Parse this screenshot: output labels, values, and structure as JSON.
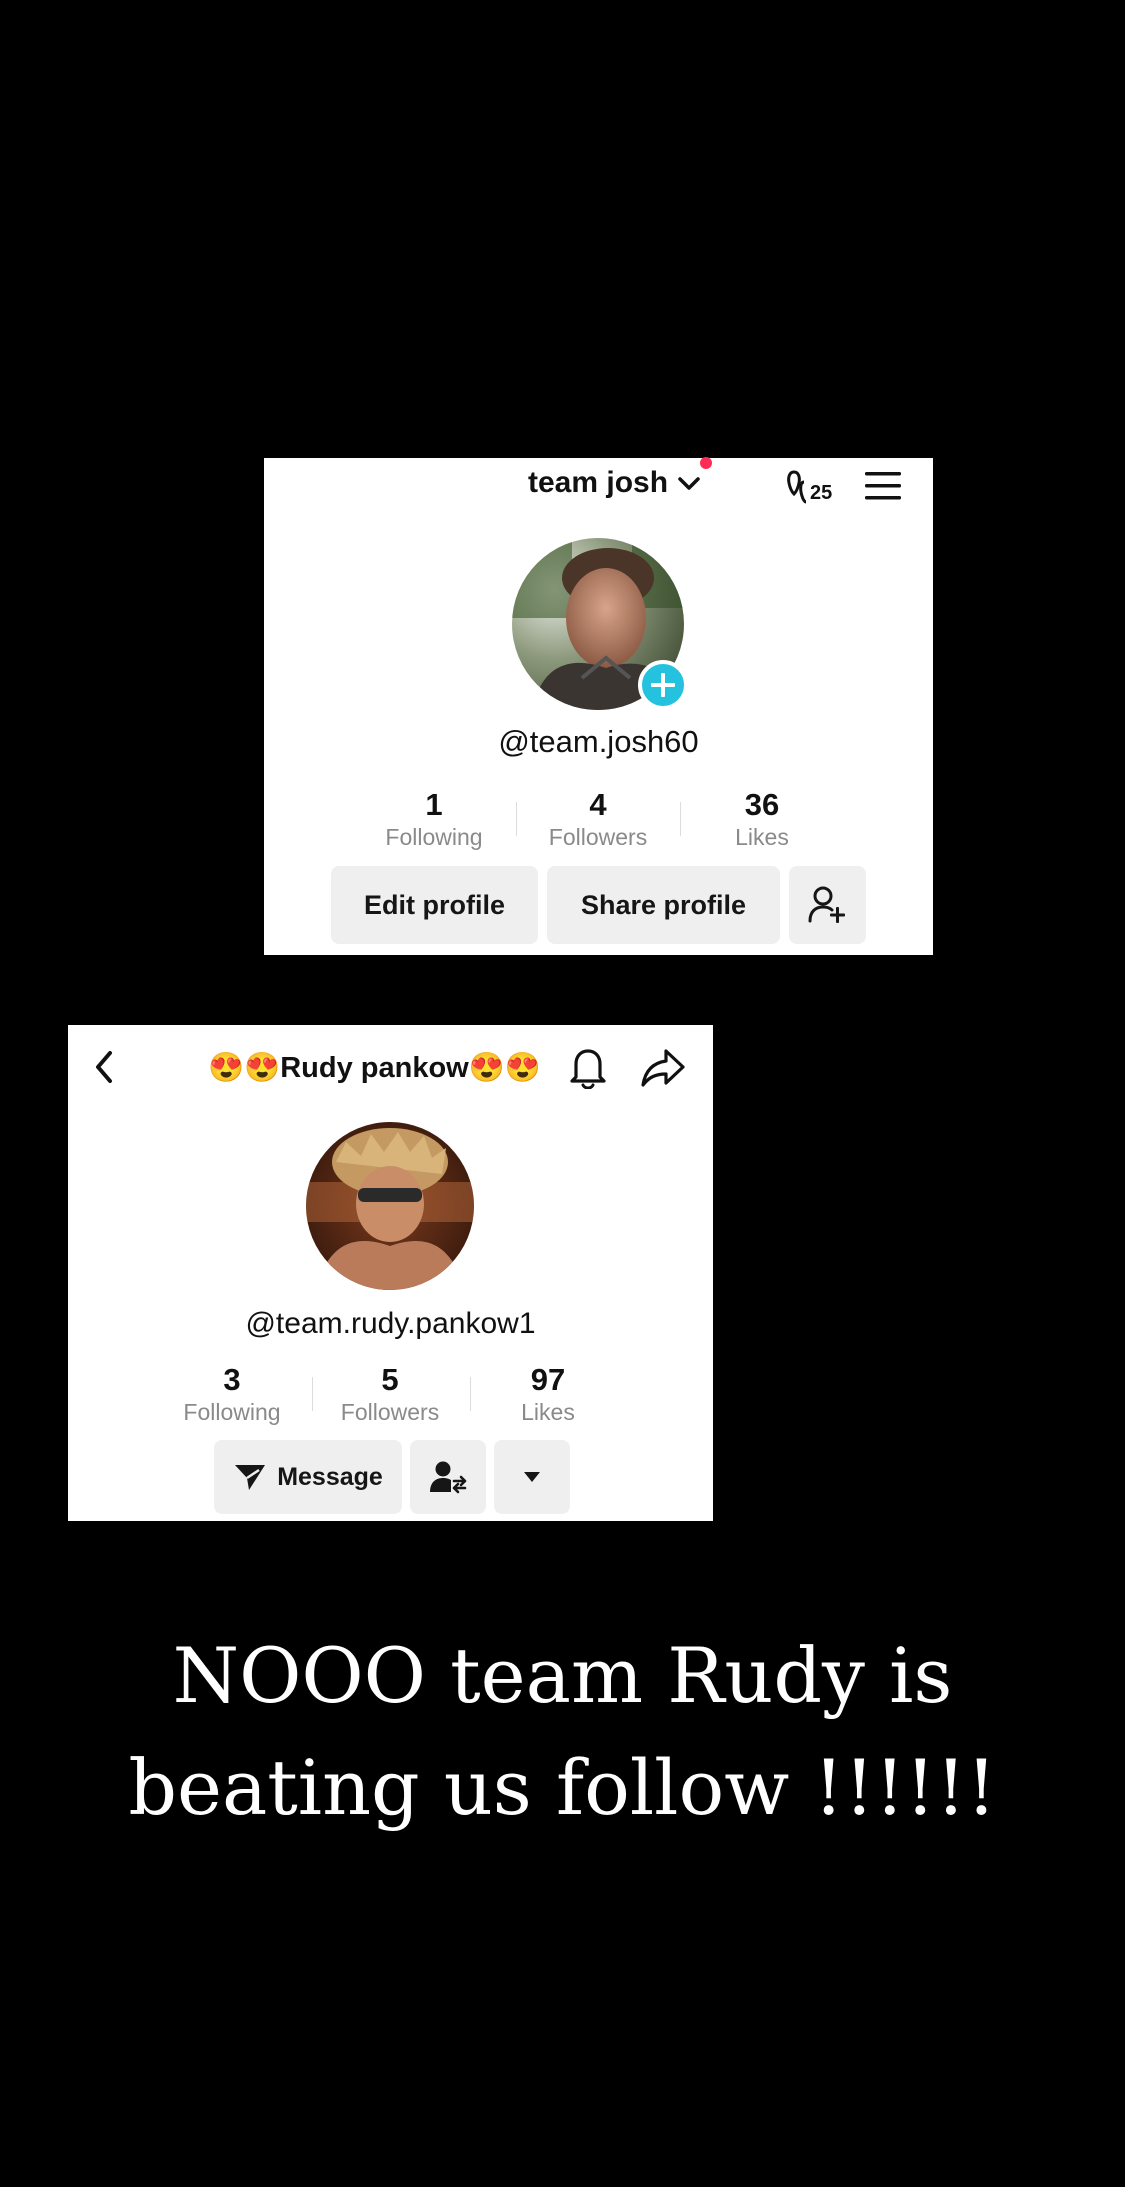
{
  "profile_mine": {
    "title": "team josh",
    "handle": "@team.josh60",
    "stats": [
      {
        "value": "1",
        "label": "Following"
      },
      {
        "value": "4",
        "label": "Followers"
      },
      {
        "value": "36",
        "label": "Likes"
      }
    ],
    "edit_label": "Edit profile",
    "share_label": "Share profile",
    "badge_count": "25",
    "icons": [
      "chevron-down-icon",
      "footprint-icon",
      "menu-icon",
      "add-story-icon",
      "add-friend-icon"
    ],
    "accent_color": "#25c2e0",
    "notification_dot_color": "#fe2c55"
  },
  "profile_other": {
    "title": "😍😍Rudy pankow😍😍",
    "handle": "@team.rudy.pankow1",
    "stats": [
      {
        "value": "3",
        "label": "Following"
      },
      {
        "value": "5",
        "label": "Followers"
      },
      {
        "value": "97",
        "label": "Likes"
      }
    ],
    "message_label": "Message",
    "icons": [
      "back-icon",
      "bell-icon",
      "share-icon",
      "send-icon",
      "friend-swap-icon",
      "dropdown-icon"
    ]
  },
  "caption": {
    "line1": "NOOO team Rudy is",
    "line2": "beating us follow !!!!!!"
  }
}
